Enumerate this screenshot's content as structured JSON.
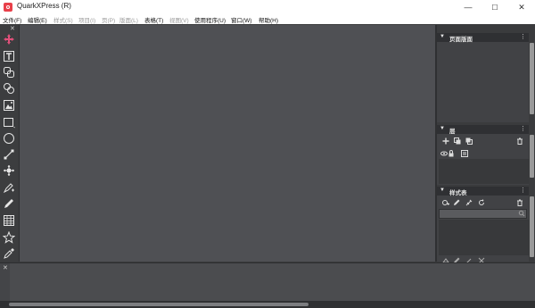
{
  "window": {
    "title": "QuarkXPress (R)",
    "minimize": "—",
    "maximize": "☐",
    "close": "✕"
  },
  "menu": [
    {
      "label": "文件(F)",
      "enabled": true
    },
    {
      "label": "编辑(E)",
      "enabled": true
    },
    {
      "label": "样式(S)",
      "enabled": false
    },
    {
      "label": "项目(I)",
      "enabled": false
    },
    {
      "label": "页(P)",
      "enabled": false
    },
    {
      "label": "版面(L)",
      "enabled": false
    },
    {
      "label": "表格(T)",
      "enabled": true
    },
    {
      "label": "视图(V)",
      "enabled": false
    },
    {
      "label": "使用程序(U)",
      "enabled": true
    },
    {
      "label": "窗口(W)",
      "enabled": true
    },
    {
      "label": "帮助(H)",
      "enabled": true
    }
  ],
  "toolbox": {
    "close": "✕",
    "tools": [
      "move-icon",
      "text-content-icon",
      "linking-icon",
      "unlinking-icon",
      "picture-content-icon",
      "rectangle-box-icon",
      "oval-box-icon",
      "line-icon",
      "pen-icon",
      "pen-add-point-icon",
      "pencil-icon",
      "table-icon",
      "starburst-icon",
      "eyedropper-icon"
    ]
  },
  "panels": {
    "page_layout": {
      "arrow": "▼",
      "title": "页面版面",
      "menu": "⋮"
    },
    "layers": {
      "arrow": "▼",
      "title": "层",
      "menu": "⋮"
    },
    "styles": {
      "arrow": "▼",
      "title": "样式表",
      "menu": "⋮"
    }
  },
  "bottom_panel": {
    "close": "✕"
  }
}
